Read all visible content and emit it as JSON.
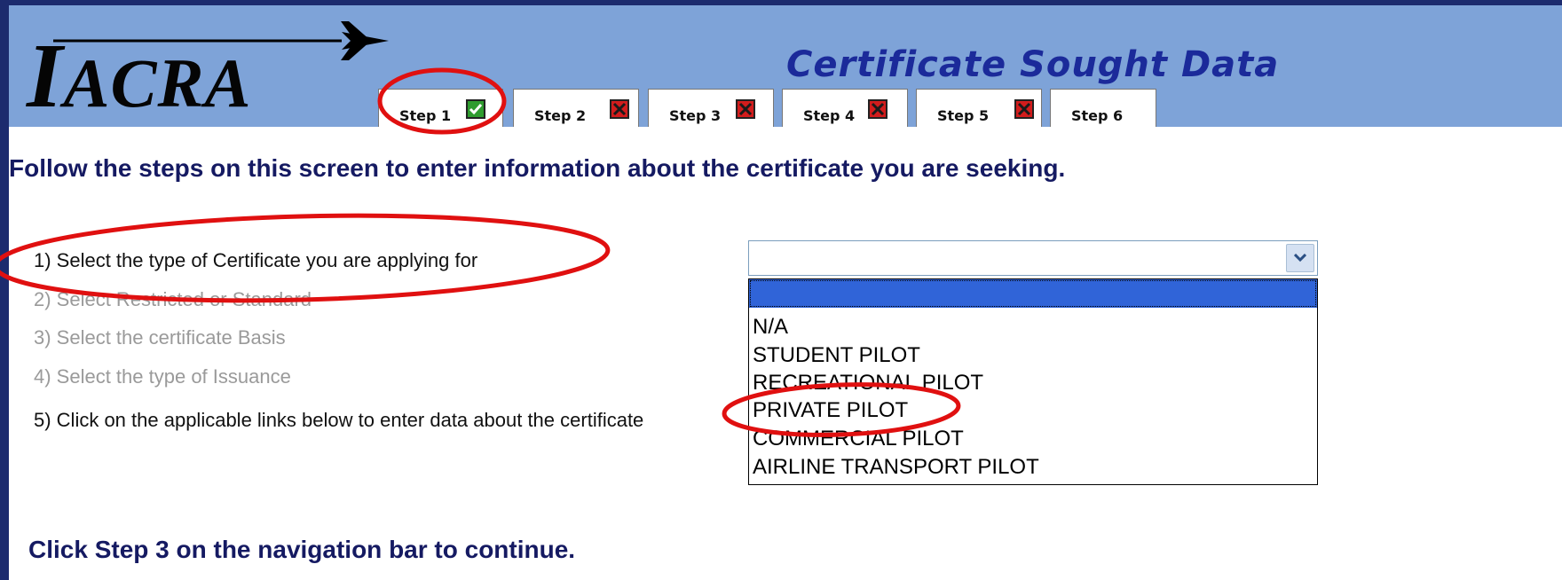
{
  "app": {
    "logo_first": "I",
    "logo_rest": "ACRA",
    "page_title": "Certificate Sought Data"
  },
  "tabs": [
    {
      "label": "Step 1",
      "status": "complete",
      "icon": "check-icon"
    },
    {
      "label": "Step 2",
      "status": "incomplete",
      "icon": "x-icon"
    },
    {
      "label": "Step 3",
      "status": "incomplete",
      "icon": "x-icon"
    },
    {
      "label": "Step 4",
      "status": "incomplete",
      "icon": "x-icon"
    },
    {
      "label": "Step 5",
      "status": "incomplete",
      "icon": "x-icon"
    },
    {
      "label": "Step 6",
      "status": "none",
      "icon": ""
    }
  ],
  "main": {
    "instruction": "Follow the steps on this screen to enter information about the certificate you are seeking.",
    "steps": [
      {
        "text": "1) Select the type of Certificate you are applying for",
        "enabled": true
      },
      {
        "text": "2) Select Restricted or Standard",
        "enabled": false
      },
      {
        "text": "3) Select the certificate Basis",
        "enabled": false
      },
      {
        "text": "4) Select the type of Issuance",
        "enabled": false
      },
      {
        "text": "5) Click on the applicable links below to enter data about the certificate",
        "enabled": true
      }
    ],
    "continue_text": "Click Step 3 on the navigation bar to continue."
  },
  "certificate_select": {
    "value": "",
    "options": [
      "",
      "N/A",
      "STUDENT PILOT",
      "RECREATIONAL PILOT",
      "PRIVATE PILOT",
      "COMMERCIAL PILOT",
      "AIRLINE TRANSPORT PILOT"
    ],
    "highlighted_index": 0
  },
  "colors": {
    "outer_border": "#1c2b6e",
    "header_bg": "#7ea3d8",
    "title_text": "#1b2a9a",
    "instruction_text": "#151a62",
    "annotation_red": "#e01010",
    "check_green": "#2f9c2f",
    "x_red": "#d21c1c",
    "selected_option_bg": "#3064d8"
  }
}
